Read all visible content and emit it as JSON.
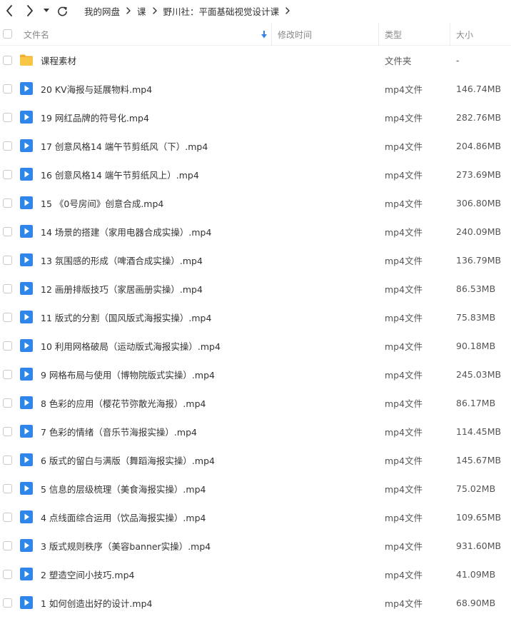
{
  "colors": {
    "accent": "#2f86e8",
    "folder": "#f8c544",
    "folder_tab": "#eeb02e",
    "header_text": "#888888"
  },
  "nav": {
    "back_icon": "chevron-left-icon",
    "forward_icon": "chevron-right-icon",
    "dropdown_icon": "caret-down-icon",
    "refresh_icon": "refresh-icon"
  },
  "breadcrumb": [
    "我的网盘",
    "课",
    "野川社：平面基础视觉设计课"
  ],
  "columns": {
    "name": "文件名",
    "modified": "修改时间",
    "type": "类型",
    "size": "大小",
    "sort_icon": "sort-down-arrow-icon"
  },
  "files": [
    {
      "name": "课程素材",
      "type": "文件夹",
      "size": "-",
      "icon": "folder-icon"
    },
    {
      "name": "20 KV海报与延展物料.mp4",
      "type": "mp4文件",
      "size": "146.74MB",
      "icon": "video-icon"
    },
    {
      "name": "19 网红品牌的符号化.mp4",
      "type": "mp4文件",
      "size": "282.76MB",
      "icon": "video-icon"
    },
    {
      "name": "17 创意风格14 端午节剪纸风（下）.mp4",
      "type": "mp4文件",
      "size": "204.86MB",
      "icon": "video-icon"
    },
    {
      "name": "16 创意风格14 端午节剪纸风上）.mp4",
      "type": "mp4文件",
      "size": "273.69MB",
      "icon": "video-icon"
    },
    {
      "name": "15 《0号房间》创意合成.mp4",
      "type": "mp4文件",
      "size": "306.80MB",
      "icon": "video-icon"
    },
    {
      "name": "14 场景的搭建（家用电器合成实操）.mp4",
      "type": "mp4文件",
      "size": "240.09MB",
      "icon": "video-icon"
    },
    {
      "name": "13 氛围感的形成（啤酒合成实操）.mp4",
      "type": "mp4文件",
      "size": "136.79MB",
      "icon": "video-icon"
    },
    {
      "name": "12 画册排版技巧（家居画册实操）.mp4",
      "type": "mp4文件",
      "size": "86.53MB",
      "icon": "video-icon"
    },
    {
      "name": "11 版式的分割（国风版式海报实操）.mp4",
      "type": "mp4文件",
      "size": "75.83MB",
      "icon": "video-icon"
    },
    {
      "name": "10 利用网格破局（运动版式海报实操）.mp4",
      "type": "mp4文件",
      "size": "90.18MB",
      "icon": "video-icon"
    },
    {
      "name": "9 网格布局与使用（博物院版式实操）.mp4",
      "type": "mp4文件",
      "size": "245.03MB",
      "icon": "video-icon"
    },
    {
      "name": "8 色彩的应用（樱花节弥散光海报）.mp4",
      "type": "mp4文件",
      "size": "86.17MB",
      "icon": "video-icon"
    },
    {
      "name": "7 色彩的情绪（音乐节海报实操）.mp4",
      "type": "mp4文件",
      "size": "114.45MB",
      "icon": "video-icon"
    },
    {
      "name": "6 版式的留白与满版（舞蹈海报实操）.mp4",
      "type": "mp4文件",
      "size": "145.67MB",
      "icon": "video-icon"
    },
    {
      "name": "5 信息的层级梳理（美食海报实操）.mp4",
      "type": "mp4文件",
      "size": "75.02MB",
      "icon": "video-icon"
    },
    {
      "name": "4 点线面综合运用（饮品海报实操）.mp4",
      "type": "mp4文件",
      "size": "109.65MB",
      "icon": "video-icon"
    },
    {
      "name": "3 版式规则秩序（美容banner实操）.mp4",
      "type": "mp4文件",
      "size": "931.60MB",
      "icon": "video-icon"
    },
    {
      "name": "2 塑造空间小技巧.mp4",
      "type": "mp4文件",
      "size": "41.09MB",
      "icon": "video-icon"
    },
    {
      "name": "1 如何创造出好的设计.mp4",
      "type": "mp4文件",
      "size": "68.90MB",
      "icon": "video-icon"
    }
  ]
}
